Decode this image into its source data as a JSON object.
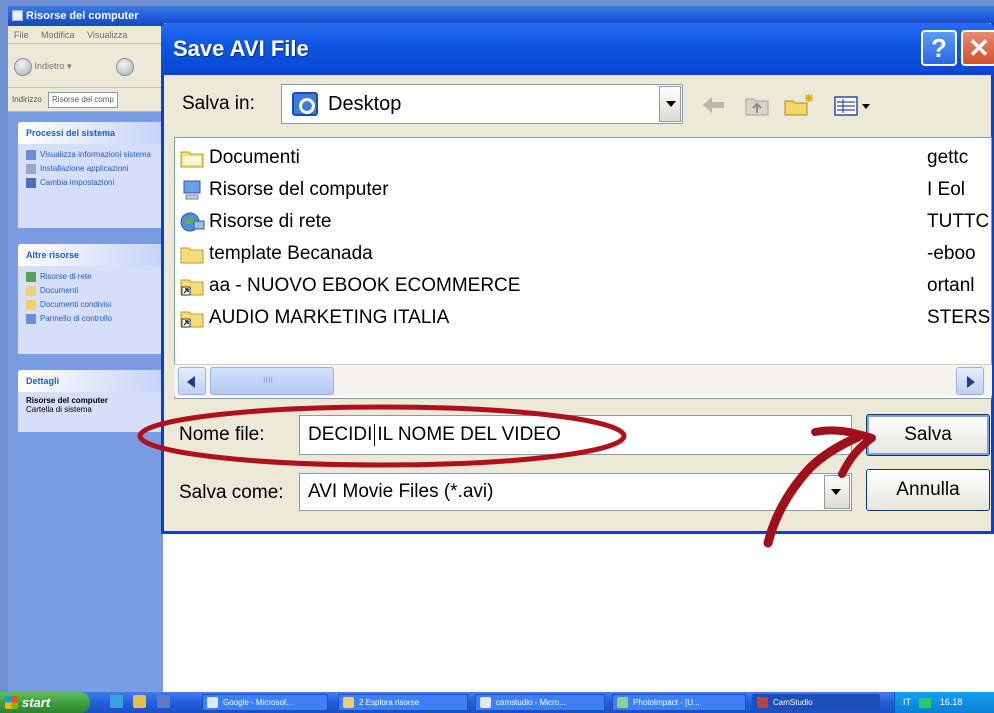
{
  "background_window": {
    "title": "Risorse del computer",
    "menu": [
      "File",
      "Modifica",
      "Visualizza"
    ],
    "back_label": "Indietro",
    "address_label": "Indirizzo",
    "address_value": "Risorse del comp",
    "panels": [
      {
        "title": "Processi del sistema",
        "items": [
          "Visualizza informazioni sistema",
          "Installazione applicazioni",
          "Cambia impostazioni"
        ]
      },
      {
        "title": "Altre risorse",
        "items": [
          "Risorse di rete",
          "Documenti",
          "Documenti condivisi",
          "Pannello di controllo"
        ]
      },
      {
        "title": "Dettagli",
        "strong": "Risorse del computer",
        "plain": "Cartella di sistema"
      }
    ]
  },
  "dialog": {
    "title": "Save AVI File",
    "help_glyph": "?",
    "close_glyph": "✕",
    "save_in_label": "Salva in:",
    "save_in_value": "Desktop",
    "files": [
      {
        "name": "Documenti",
        "icon": "folder-icon"
      },
      {
        "name": "Risorse del computer",
        "icon": "computer-icon"
      },
      {
        "name": "Risorse di rete",
        "icon": "network-icon"
      },
      {
        "name": "template Becanada",
        "icon": "folder-icon"
      },
      {
        "name": "aa - NUOVO EBOOK ECOMMERCE",
        "icon": "folder-shortcut-icon"
      },
      {
        "name": "AUDIO MARKETING ITALIA",
        "icon": "folder-shortcut-icon"
      }
    ],
    "files_col2": [
      "gettc",
      "I Eol",
      "TUTTC",
      "-eboo",
      "ortanl",
      "STERS"
    ],
    "filename_label": "Nome file:",
    "filename_value_a": "DECIDI",
    "filename_value_b": "IL NOME DEL VIDEO",
    "savetype_label": "Salva come:",
    "savetype_value": "AVI Movie Files (*.avi)",
    "save_button": "Salva",
    "cancel_button": "Annulla"
  },
  "taskbar": {
    "start_label": "start",
    "tasks": [
      "Google - Microsof...",
      "2 Esplora risorse",
      "camstudio - Micro...",
      "PhotoImpact - [U...",
      "CamStudio"
    ],
    "tray_lang": "IT",
    "tray_time": "16.18"
  },
  "colors": {
    "titlebar_blue": "#0a47cf",
    "dialog_face": "#ece9d8",
    "annotation_red": "#b0101a"
  }
}
